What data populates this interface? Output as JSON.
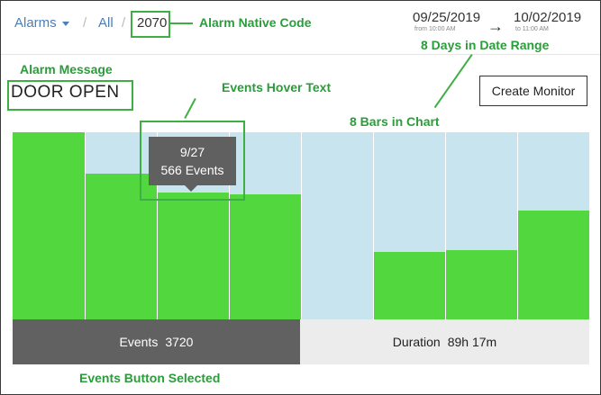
{
  "breadcrumb": {
    "alarms": "Alarms",
    "sep": "/",
    "all": "All",
    "code": "2070"
  },
  "date_range": {
    "from_date": "09/25/2019",
    "from_time": "from 10:00 AM",
    "to_date": "10/02/2019",
    "to_time": "to 11:00 AM",
    "arrow": "→"
  },
  "alarm": {
    "message": "DOOR OPEN"
  },
  "actions": {
    "create_monitor": "Create Monitor"
  },
  "annotations": {
    "native_code": "Alarm Native Code",
    "date_range": "8 Days in Date Range",
    "message": "Alarm Message",
    "hover": "Events Hover Text",
    "bars": "8 Bars in Chart",
    "events_selected": "Events Button Selected"
  },
  "tooltip": {
    "date": "9/27",
    "events": "566 Events"
  },
  "toggles": {
    "events_label": "Events",
    "events_value": "3720",
    "duration_label": "Duration",
    "duration_value": "89h 17m"
  },
  "colors": {
    "bar": "#52d83e",
    "bar_background": "#c7e4ef",
    "annotation": "#2a9d3a",
    "link": "#4a7fb8",
    "selected_toggle": "#616161"
  },
  "chart_data": {
    "type": "bar",
    "values": [
      1.0,
      0.78,
      0.68,
      0.67,
      0.0,
      0.36,
      0.37,
      0.58
    ],
    "highlighted_index": 2
  }
}
